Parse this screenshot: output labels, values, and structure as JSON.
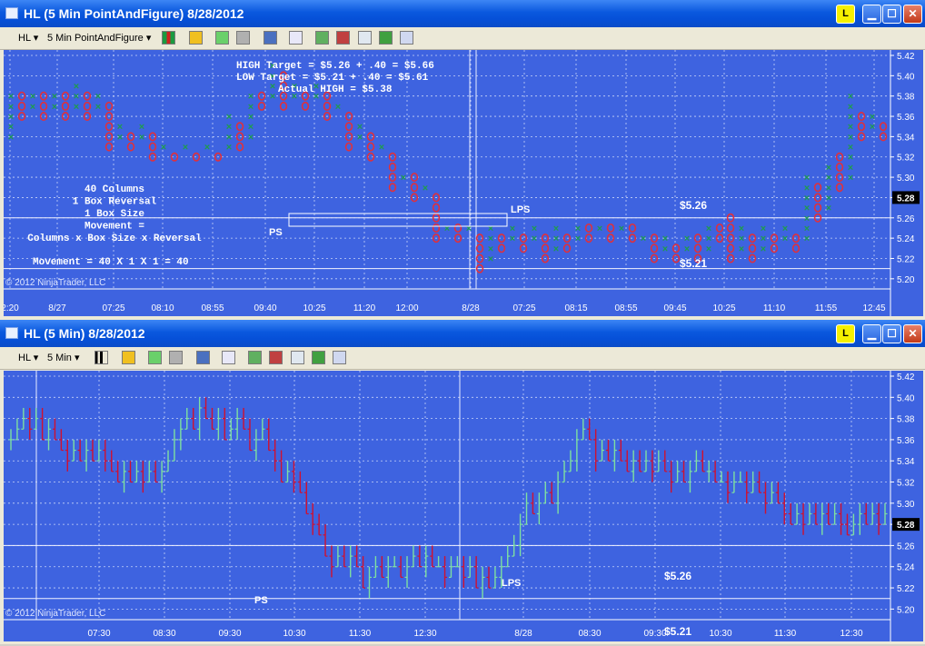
{
  "top_window": {
    "title": "HL (5 Min PointAndFigure)  8/28/2012",
    "link_button": "L",
    "toolbar": {
      "instrument": "HL",
      "period": "5 Min PointAndFigure"
    },
    "copyright": "© 2012 NinjaTrader, LLC",
    "price_ticks": [
      "5.42",
      "5.40",
      "5.38",
      "5.36",
      "5.34",
      "5.32",
      "5.30",
      "5.28",
      "5.26",
      "5.24",
      "5.22",
      "5.20"
    ],
    "last_price": "5.28",
    "time_ticks": [
      "2:20",
      "8/27",
      "07:25",
      "08:10",
      "08:55",
      "09:40",
      "10:25",
      "11:20",
      "12:00",
      "8/28",
      "07:25",
      "08:15",
      "08:55",
      "09:45",
      "10:25",
      "11:10",
      "11:55",
      "12:45"
    ],
    "annotations": {
      "targets": [
        "HIGH Target = $5.26 + .40 = $5.66",
        "LOW Target =  $5.21 + .40 = $5.61",
        "Actual HIGH = $5.38"
      ],
      "method": [
        "40 Columns",
        "1 Box Reversal",
        "1 Box Size",
        "Movement =",
        "Columns x Box Size x Reversal"
      ],
      "movement": "Movement = 40 X 1 X 1 = 40",
      "ps": "PS",
      "lps": "LPS",
      "level_high": "$5.26",
      "level_low": "$5.21"
    }
  },
  "bottom_window": {
    "title": "HL (5 Min)  8/28/2012",
    "link_button": "L",
    "toolbar": {
      "instrument": "HL",
      "period": "5 Min"
    },
    "copyright": "© 2012 NinjaTrader, LLC",
    "price_ticks": [
      "5.42",
      "5.40",
      "5.38",
      "5.36",
      "5.34",
      "5.32",
      "5.30",
      "5.28",
      "5.26",
      "5.24",
      "5.22",
      "5.20"
    ],
    "last_price": "5.28",
    "time_ticks": [
      "07:30",
      "08:30",
      "09:30",
      "10:30",
      "11:30",
      "12:30",
      "8/28",
      "08:30",
      "09:30",
      "10:30",
      "11:30",
      "12:30"
    ],
    "annotations": {
      "ps": "PS",
      "lps": "LPS",
      "level_high": "$5.26",
      "level_low": "$5.21"
    }
  },
  "colors": {
    "chart_bg": "#3e63e0",
    "up": "#7ee0a0",
    "down": "#d01030",
    "x_mark": "#1f9a50",
    "o_mark": "#e0303c"
  },
  "chart_data": [
    {
      "type": "point-and-figure",
      "box_size": 0.01,
      "reversal": 1,
      "ylim": [
        5.19,
        5.42
      ],
      "levels": [
        5.26,
        5.21
      ],
      "columns": [
        {
          "t": "x",
          "lo": 5.34,
          "hi": 5.38
        },
        {
          "t": "o",
          "lo": 5.36,
          "hi": 5.38
        },
        {
          "t": "x",
          "lo": 5.37,
          "hi": 5.38
        },
        {
          "t": "o",
          "lo": 5.36,
          "hi": 5.38
        },
        {
          "t": "x",
          "lo": 5.37,
          "hi": 5.38
        },
        {
          "t": "o",
          "lo": 5.36,
          "hi": 5.38
        },
        {
          "t": "x",
          "lo": 5.37,
          "hi": 5.39
        },
        {
          "t": "o",
          "lo": 5.36,
          "hi": 5.38
        },
        {
          "t": "x",
          "lo": 5.37,
          "hi": 5.38
        },
        {
          "t": "o",
          "lo": 5.33,
          "hi": 5.37
        },
        {
          "t": "x",
          "lo": 5.34,
          "hi": 5.35
        },
        {
          "t": "o",
          "lo": 5.33,
          "hi": 5.34
        },
        {
          "t": "x",
          "lo": 5.34,
          "hi": 5.35
        },
        {
          "t": "o",
          "lo": 5.32,
          "hi": 5.34
        },
        {
          "t": "x",
          "lo": 5.33,
          "hi": 5.33
        },
        {
          "t": "o",
          "lo": 5.32,
          "hi": 5.32
        },
        {
          "t": "x",
          "lo": 5.33,
          "hi": 5.33
        },
        {
          "t": "o",
          "lo": 5.32,
          "hi": 5.32
        },
        {
          "t": "x",
          "lo": 5.33,
          "hi": 5.33
        },
        {
          "t": "o",
          "lo": 5.32,
          "hi": 5.32
        },
        {
          "t": "x",
          "lo": 5.33,
          "hi": 5.36
        },
        {
          "t": "o",
          "lo": 5.33,
          "hi": 5.35
        },
        {
          "t": "x",
          "lo": 5.34,
          "hi": 5.38
        },
        {
          "t": "o",
          "lo": 5.37,
          "hi": 5.38
        },
        {
          "t": "x",
          "lo": 5.38,
          "hi": 5.41
        },
        {
          "t": "o",
          "lo": 5.37,
          "hi": 5.4
        },
        {
          "t": "x",
          "lo": 5.38,
          "hi": 5.39
        },
        {
          "t": "o",
          "lo": 5.37,
          "hi": 5.38
        },
        {
          "t": "x",
          "lo": 5.38,
          "hi": 5.39
        },
        {
          "t": "o",
          "lo": 5.36,
          "hi": 5.38
        },
        {
          "t": "x",
          "lo": 5.37,
          "hi": 5.37
        },
        {
          "t": "o",
          "lo": 5.33,
          "hi": 5.36
        },
        {
          "t": "x",
          "lo": 5.34,
          "hi": 5.35
        },
        {
          "t": "o",
          "lo": 5.32,
          "hi": 5.34
        },
        {
          "t": "x",
          "lo": 5.33,
          "hi": 5.33
        },
        {
          "t": "o",
          "lo": 5.29,
          "hi": 5.32
        },
        {
          "t": "x",
          "lo": 5.3,
          "hi": 5.3
        },
        {
          "t": "o",
          "lo": 5.28,
          "hi": 5.3
        },
        {
          "t": "x",
          "lo": 5.29,
          "hi": 5.29
        },
        {
          "t": "o",
          "lo": 5.24,
          "hi": 5.28
        }
      ]
    },
    {
      "type": "ohlc",
      "ylim": [
        5.19,
        5.42
      ],
      "levels": [
        5.26,
        5.21
      ],
      "session_break_index": 80,
      "closes": [
        5.36,
        5.37,
        5.38,
        5.37,
        5.38,
        5.36,
        5.37,
        5.36,
        5.35,
        5.34,
        5.35,
        5.34,
        5.35,
        5.34,
        5.35,
        5.34,
        5.33,
        5.32,
        5.33,
        5.32,
        5.33,
        5.32,
        5.33,
        5.32,
        5.33,
        5.34,
        5.36,
        5.37,
        5.38,
        5.37,
        5.39,
        5.38,
        5.37,
        5.38,
        5.36,
        5.37,
        5.38,
        5.37,
        5.35,
        5.36,
        5.37,
        5.35,
        5.34,
        5.32,
        5.33,
        5.32,
        5.31,
        5.29,
        5.28,
        5.27,
        5.25,
        5.24,
        5.25,
        5.24,
        5.25,
        5.24,
        5.22,
        5.23,
        5.24,
        5.23,
        5.24,
        5.24,
        5.23,
        5.24,
        5.25,
        5.24,
        5.25,
        5.24,
        5.24,
        5.23,
        5.24,
        5.24,
        5.23,
        5.24,
        5.22,
        5.23,
        5.22,
        5.23,
        5.24,
        5.25,
        5.26,
        5.28,
        5.3,
        5.29,
        5.3,
        5.31,
        5.3,
        5.32,
        5.33,
        5.34,
        5.36,
        5.37,
        5.36,
        5.34,
        5.35,
        5.34,
        5.35,
        5.34,
        5.33,
        5.34,
        5.33,
        5.34,
        5.33,
        5.34,
        5.33,
        5.32,
        5.33,
        5.32,
        5.33,
        5.34,
        5.33,
        5.33,
        5.32,
        5.32,
        5.31,
        5.32,
        5.32,
        5.31,
        5.32,
        5.31,
        5.3,
        5.31,
        5.3,
        5.29,
        5.28,
        5.29,
        5.28,
        5.29,
        5.28,
        5.29,
        5.28,
        5.29,
        5.28,
        5.27,
        5.28,
        5.29,
        5.28,
        5.29,
        5.28,
        5.29
      ]
    }
  ]
}
